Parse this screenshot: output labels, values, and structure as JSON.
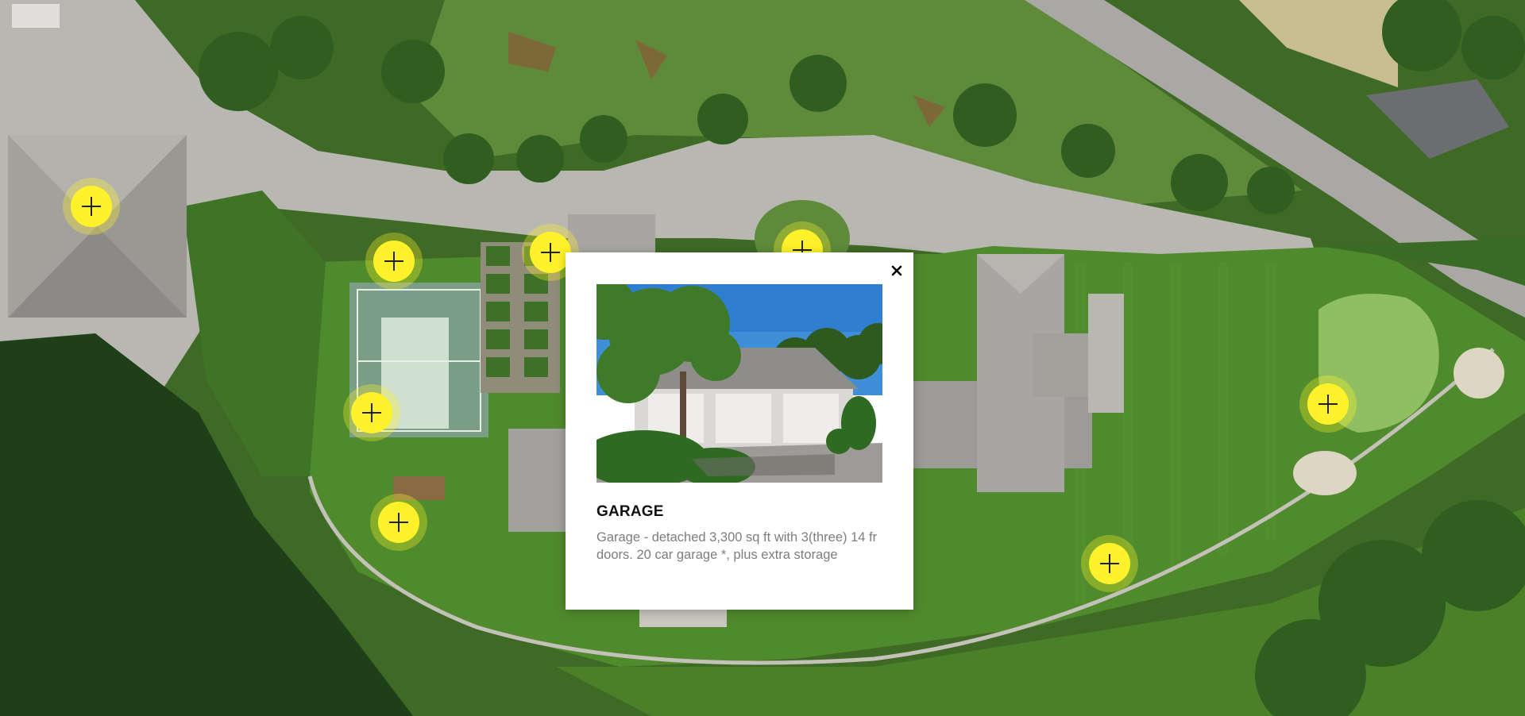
{
  "hotspots": [
    {
      "name": "hotspot-guest-house"
    },
    {
      "name": "hotspot-shed"
    },
    {
      "name": "hotspot-garden"
    },
    {
      "name": "hotspot-roundabout"
    },
    {
      "name": "hotspot-sport-court"
    },
    {
      "name": "hotspot-playset"
    },
    {
      "name": "hotspot-putting-green"
    },
    {
      "name": "hotspot-lawn"
    }
  ],
  "popup": {
    "title": "GARAGE",
    "description": "Garage - detached 3,300 sq ft with 3(three) 14 fr doors. 20 car garage *, plus extra storage",
    "close_icon": "close-icon",
    "photo": "garage-photo"
  },
  "colors": {
    "hotspot": "#fff22a",
    "lawn": "#4f8a2c",
    "driveway": "#b9b7b1",
    "roof": "#a8a6a2"
  }
}
